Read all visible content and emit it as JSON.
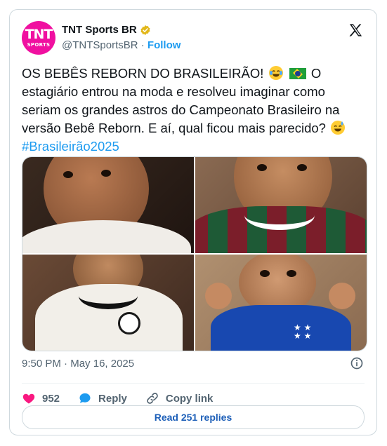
{
  "account": {
    "avatar_text": "TNT",
    "avatar_subtext": "SPORTS",
    "name": "TNT Sports BR",
    "handle": "@TNTSportsBR",
    "separator": "·",
    "follow_label": "Follow"
  },
  "tweet": {
    "text_part1": "OS BEBÊS REBORN DO BRASILEIRÃO!",
    "text_part2": "O estagiário entrou na moda e resolveu imaginar como seriam os grandes astros do Campeonato Brasileiro na versão Bebê Reborn. E aí, qual ficou mais parecido?",
    "hashtag": "#Brasileirão2025",
    "emojis": [
      "laughing-crying-emoji",
      "brazil-flag-emoji",
      "sweat-smile-emoji"
    ]
  },
  "media": {
    "images": [
      {
        "name": "baby-white-shirt-tattoo"
      },
      {
        "name": "baby-fluminense-jersey"
      },
      {
        "name": "baby-corinthians-shirt"
      },
      {
        "name": "baby-cruzeiro-jersey"
      }
    ]
  },
  "meta": {
    "time": "9:50 PM",
    "separator": "·",
    "date": "May 16, 2025"
  },
  "actions": {
    "like_count": "952",
    "reply_label": "Reply",
    "copy_label": "Copy link",
    "read_replies_label": "Read 251 replies"
  },
  "colors": {
    "accent": "#1d9bf0",
    "like": "#f91880",
    "avatar": "#f010a0"
  }
}
